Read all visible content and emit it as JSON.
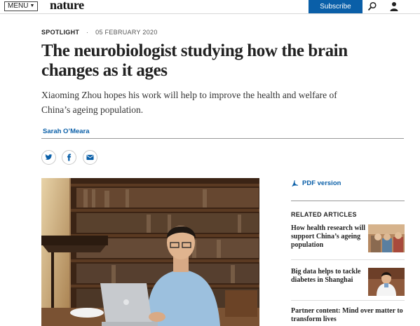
{
  "header": {
    "menu_label": "MENU",
    "logo": "nature",
    "subscribe_label": "Subscribe",
    "search_icon": "search-icon",
    "account_icon": "user-icon"
  },
  "article": {
    "kind": "SPOTLIGHT",
    "separator": "·",
    "date": "05 FEBRUARY 2020",
    "title": "The neurobiologist studying how the brain changes as it ages",
    "standfirst": "Xiaoming Zhou hopes his work will help to improve the health and welfare of China’s ageing population.",
    "author": "Sarah O’Meara",
    "share": [
      "twitter-icon",
      "facebook-icon",
      "email-icon"
    ],
    "photo": "photo of researcher at laptop in library"
  },
  "sidebar": {
    "pdf_label": "PDF version",
    "related_heading": "RELATED ARTICLES",
    "related": [
      {
        "title": "How health research will support China’s ageing population"
      },
      {
        "title": "Big data helps to tackle diabetes in Shanghai"
      },
      {
        "title": "Partner content: Mind over matter to transform lives"
      }
    ]
  },
  "colors": {
    "brand_blue": "#0a5fa8",
    "text": "#222222"
  }
}
